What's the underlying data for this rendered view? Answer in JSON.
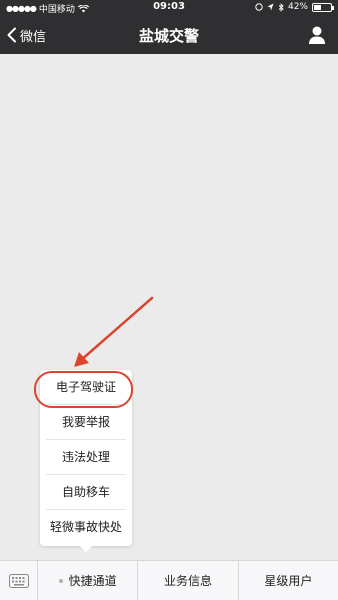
{
  "status_bar": {
    "carrier": "中国移动",
    "time": "09:03",
    "battery": "42%",
    "battery_level": 0.42
  },
  "nav": {
    "back_label": "微信",
    "title": "盐城交警"
  },
  "menu": {
    "items": [
      "电子驾驶证",
      "我要举报",
      "违法处理",
      "自助移车",
      "轻微事故快处"
    ]
  },
  "bottom_bar": {
    "tabs": [
      "快捷通道",
      "业务信息",
      "星级用户"
    ]
  },
  "colors": {
    "nav_bg": "#2f2f31",
    "highlight": "#d9452e"
  },
  "icons": [
    "signal-dots-icon",
    "wifi-icon",
    "location-icon",
    "bluetooth-icon",
    "battery-icon",
    "back-chevron-icon",
    "profile-icon",
    "keyboard-icon"
  ]
}
